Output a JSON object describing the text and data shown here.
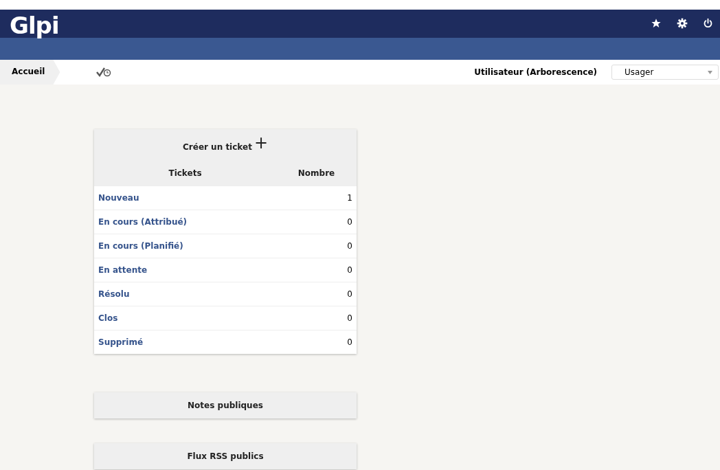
{
  "header": {
    "logo": "Glpi"
  },
  "breadcrumb": {
    "home": "Accueil"
  },
  "profile": {
    "label": "Utilisateur (Arborescence)",
    "value": "Usager"
  },
  "tickets": {
    "create": "Créer un ticket",
    "create_icon": "+",
    "columns": [
      "Tickets",
      "Nombre"
    ],
    "rows": [
      {
        "status": "Nouveau",
        "count": "1"
      },
      {
        "status": "En cours (Attribué)",
        "count": "0"
      },
      {
        "status": "En cours (Planifié)",
        "count": "0"
      },
      {
        "status": "En attente",
        "count": "0"
      },
      {
        "status": "Résolu",
        "count": "0"
      },
      {
        "status": "Clos",
        "count": "0"
      },
      {
        "status": "Supprimé",
        "count": "0"
      }
    ]
  },
  "panels": [
    "Notes publiques",
    "Flux RSS publics"
  ]
}
